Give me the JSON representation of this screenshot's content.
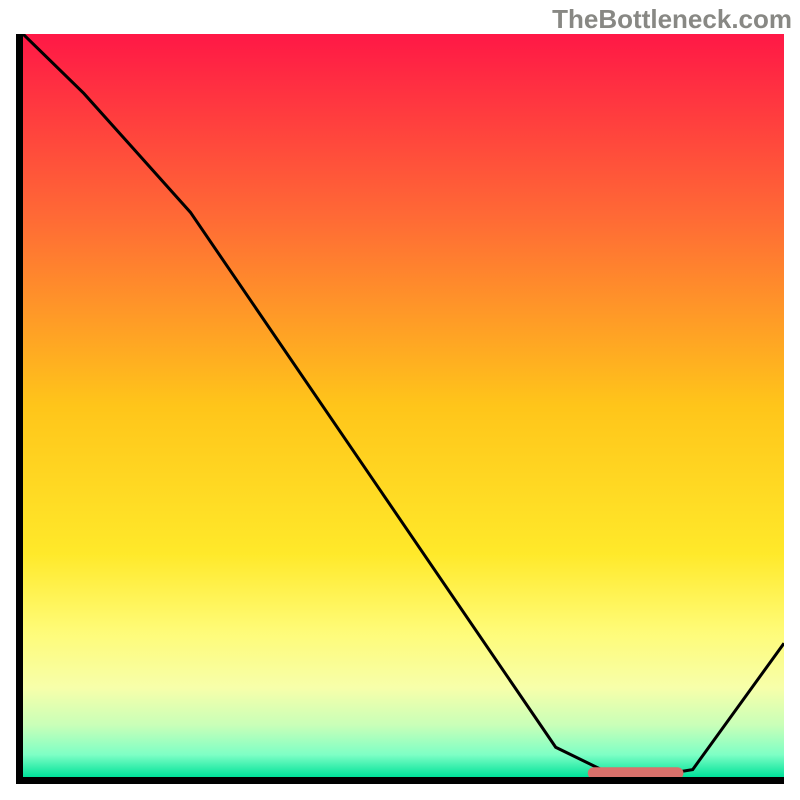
{
  "watermark": "TheBottleneck.com",
  "chart_data": {
    "type": "line",
    "title": "",
    "xlabel": "",
    "ylabel": "",
    "xlim": [
      0,
      100
    ],
    "ylim": [
      0,
      100
    ],
    "grid": false,
    "background": {
      "gradient_stops": [
        {
          "offset": 0.0,
          "color": "#ff1846"
        },
        {
          "offset": 0.25,
          "color": "#ff6b35"
        },
        {
          "offset": 0.5,
          "color": "#ffc51a"
        },
        {
          "offset": 0.7,
          "color": "#ffe92a"
        },
        {
          "offset": 0.8,
          "color": "#fffb75"
        },
        {
          "offset": 0.88,
          "color": "#f7ffaa"
        },
        {
          "offset": 0.93,
          "color": "#c9ffb8"
        },
        {
          "offset": 0.97,
          "color": "#7effc5"
        },
        {
          "offset": 1.0,
          "color": "#00e29a"
        }
      ]
    },
    "series": [
      {
        "name": "bottleneck-curve",
        "stroke": "#000000",
        "stroke_width": 3,
        "x": [
          0,
          8,
          22,
          70,
          78,
          82,
          88,
          100
        ],
        "y": [
          100,
          92,
          76,
          4,
          0,
          0,
          1,
          18
        ]
      }
    ],
    "marker": {
      "name": "optimal-range-marker",
      "x_start": 75,
      "x_end": 86,
      "y": 0.5,
      "color": "#d9716b",
      "thickness": 12,
      "cap": "round"
    }
  }
}
